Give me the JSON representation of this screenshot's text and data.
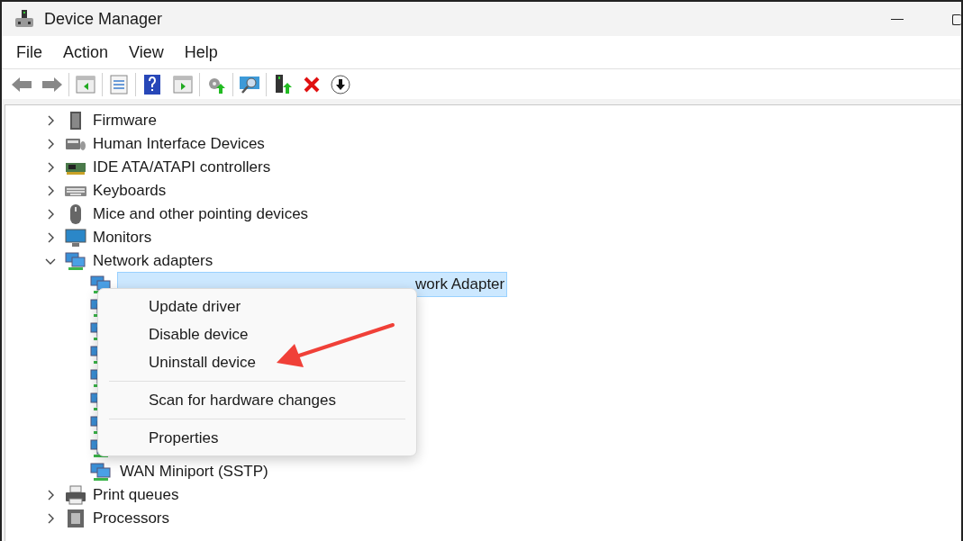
{
  "window": {
    "title": "Device Manager"
  },
  "menu": [
    "File",
    "Action",
    "View",
    "Help"
  ],
  "tree": [
    {
      "label": "Firmware",
      "kind": "firmware",
      "expanded": false
    },
    {
      "label": "Human Interface Devices",
      "kind": "hid",
      "expanded": false
    },
    {
      "label": "IDE ATA/ATAPI controllers",
      "kind": "ide",
      "expanded": false
    },
    {
      "label": "Keyboards",
      "kind": "keyboard",
      "expanded": false
    },
    {
      "label": "Mice and other pointing devices",
      "kind": "mouse",
      "expanded": false
    },
    {
      "label": "Monitors",
      "kind": "monitor",
      "expanded": false
    },
    {
      "label": "Network adapters",
      "kind": "network",
      "expanded": true,
      "children": [
        {
          "label": "work Adapter",
          "kind": "network",
          "selected": true
        },
        {
          "kind": "network"
        },
        {
          "kind": "network"
        },
        {
          "kind": "network"
        },
        {
          "kind": "network"
        },
        {
          "kind": "network"
        },
        {
          "kind": "network"
        },
        {
          "kind": "network"
        },
        {
          "label": "WAN Miniport (SSTP)",
          "kind": "network",
          "selected": false
        }
      ]
    },
    {
      "label": "Print queues",
      "kind": "printer",
      "expanded": false
    },
    {
      "label": "Processors",
      "kind": "processor",
      "expanded": false
    }
  ],
  "context_menu": [
    {
      "label": "Update driver",
      "kind": "item"
    },
    {
      "label": "Disable device",
      "kind": "item"
    },
    {
      "label": "Uninstall device",
      "kind": "item"
    },
    {
      "kind": "separator"
    },
    {
      "label": "Scan for hardware changes",
      "kind": "item"
    },
    {
      "kind": "separator"
    },
    {
      "label": "Properties",
      "kind": "item"
    }
  ]
}
